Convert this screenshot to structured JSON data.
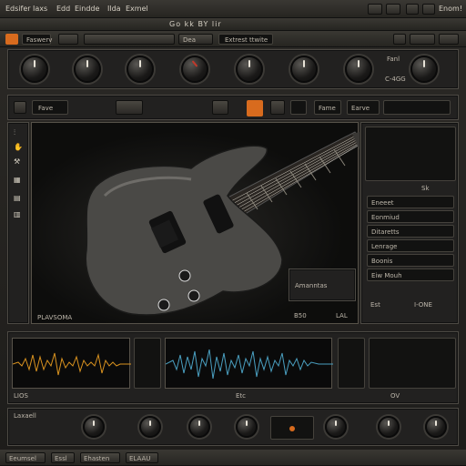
{
  "menubar": {
    "items": [
      "Edsifer",
      "Iaxs",
      "Edd",
      "Eindde",
      "Ilda",
      "Exmel"
    ],
    "right_label": "Enom!"
  },
  "toolbar": {
    "search_value": "Faswerv",
    "center_title": "Go kk BY lir",
    "field_label": "Dea",
    "preset_label": "Extrest ttwite"
  },
  "knob_row": {
    "label_right_top": "Fanl",
    "label_right_bottom": "C-4GG"
  },
  "main_strip": {
    "field_label": "Fave",
    "center_label": "Fame",
    "right_label": "Earve"
  },
  "left_tools": {
    "icon_labels": [
      "tuner-icon",
      "hand-icon",
      "wrench-icon",
      "film-icon",
      "ruler-icon",
      "grid-icon"
    ]
  },
  "viewport": {
    "caption": "PLAVSOMA",
    "bottom_right_a": "B50",
    "bottom_right_b": "LAL",
    "amp_label": "Amanntas"
  },
  "right_panel": {
    "header": "Sk",
    "list_items": [
      "Eneeet",
      "Eonmiud",
      "Ditaretts",
      "Lenrage",
      "Boonis",
      "Eiw Mouh"
    ],
    "bottom_labels": [
      "Est",
      "I-ONE"
    ]
  },
  "tracks": {
    "wave_color": "#d9921f",
    "scope_color": "#4a9fc0",
    "bottom_labels": [
      "LIOS",
      "Etc",
      "OV"
    ],
    "left_icon": "headphone-icon",
    "right_icon": "person-icon"
  },
  "bottom_controls": {
    "left_label": "Laxaell",
    "bottom_tabs": [
      "Eeumsel",
      "Essl",
      "Ehasten",
      "ELAAU"
    ]
  },
  "colors": {
    "accent": "#d86b1e",
    "background": "#1d1c1a"
  }
}
